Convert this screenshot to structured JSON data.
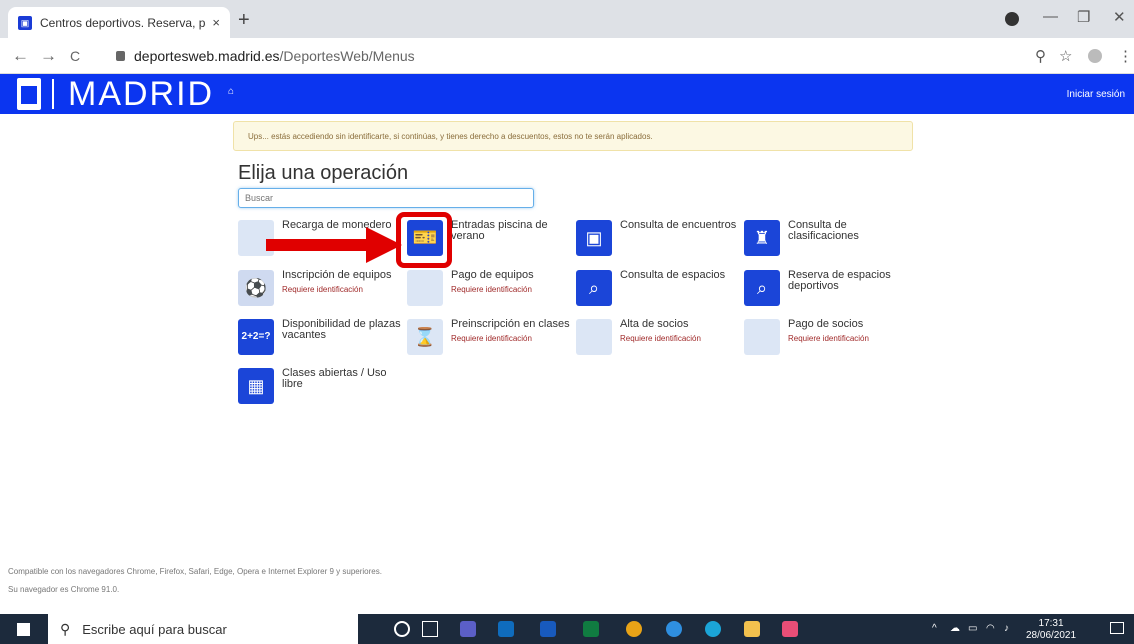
{
  "browser": {
    "tab_title": "Centros deportivos. Reserva, pag",
    "tab_close": "×",
    "new_tab": "+",
    "url_host": "deportesweb.madrid.es",
    "url_path": "/DeportesWeb/Menus",
    "back": "←",
    "forward": "→",
    "reload": "C",
    "zoom_icon": "⚲",
    "star_icon": "☆",
    "menu_icon": "⋮",
    "min": "—",
    "max": "❐",
    "close": "✕"
  },
  "header": {
    "brand": "MADRID",
    "home_glyph": "⌂",
    "login": "Iniciar sesión",
    "color": "#0b35f0"
  },
  "warning": "Ups... estás accediendo sin identificarte, si continúas, y tienes derecho a descuentos, estos no te serán aplicados.",
  "title": "Elija una operación",
  "search": {
    "placeholder": "Buscar"
  },
  "operations": [
    {
      "name": "Recarga de monedero",
      "req": ""
    },
    {
      "name": "Entradas piscina de verano",
      "req": ""
    },
    {
      "name": "Consulta de encuentros",
      "req": ""
    },
    {
      "name": "Consulta de clasificaciones",
      "req": ""
    },
    {
      "name": "Inscripción de equipos",
      "req": "Requiere identificación"
    },
    {
      "name": "Pago de equipos",
      "req": "Requiere identificación"
    },
    {
      "name": "Consulta de espacios",
      "req": ""
    },
    {
      "name": "Reserva de espacios deportivos",
      "req": ""
    },
    {
      "name": "Disponibilidad de plazas vacantes",
      "req": "",
      "icon_text": "2+2=?"
    },
    {
      "name": "Preinscripción en clases",
      "req": "Requiere identificación"
    },
    {
      "name": "Alta de socios",
      "req": "Requiere identificación"
    },
    {
      "name": "Pago de socios",
      "req": "Requiere identificación"
    },
    {
      "name": "Clases abiertas / Uso libre",
      "req": ""
    }
  ],
  "footer": {
    "compat": "Compatible con los navegadores Chrome, Firefox, Safari, Edge, Opera e Internet Explorer 9 y superiores.",
    "browser": "Su navegador es Chrome 91.0."
  },
  "taskbar": {
    "search_placeholder": "Escribe aquí para buscar",
    "search_glyph": "⚲",
    "time": "17:31",
    "date": "28/06/2021"
  }
}
